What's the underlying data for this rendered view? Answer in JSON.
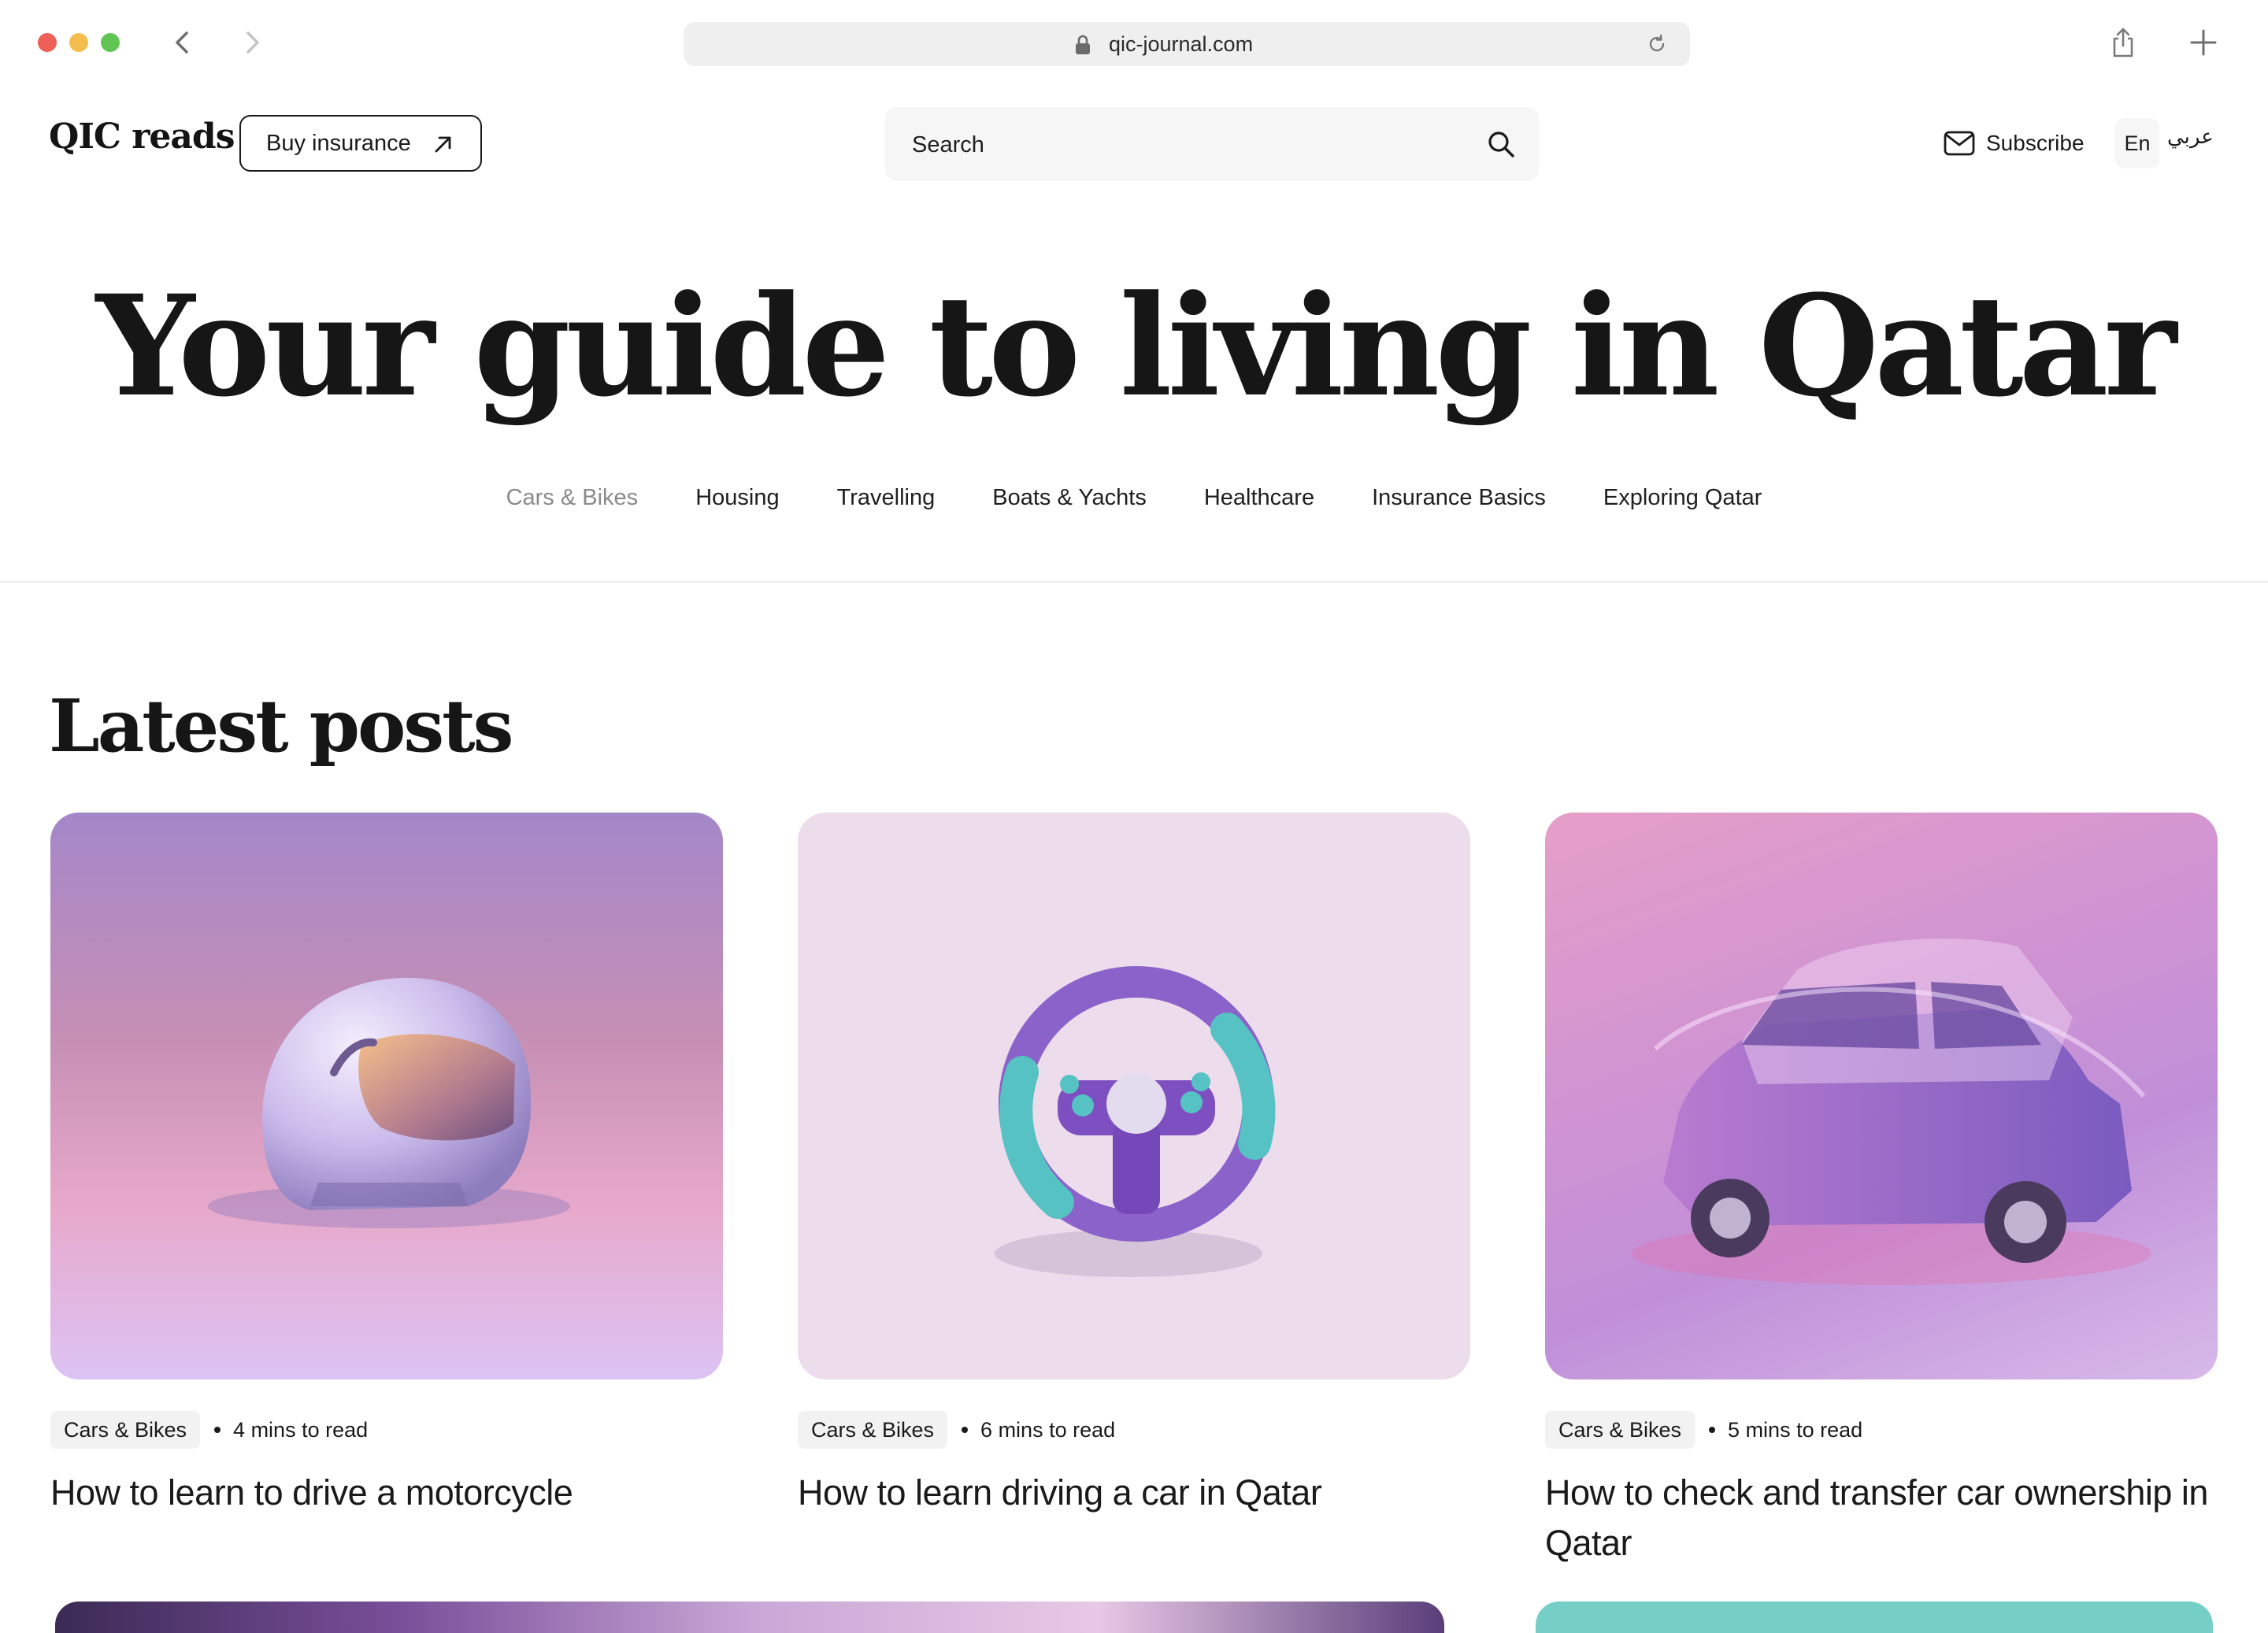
{
  "browser": {
    "url": "qic-journal.com"
  },
  "header": {
    "logo": "QIC reads",
    "buy_label": "Buy insurance",
    "search_placeholder": "Search",
    "subscribe_label": "Subscribe",
    "lang_en": "En",
    "lang_ar": "عربي"
  },
  "hero": {
    "title": "Your guide to living in Qatar"
  },
  "categories": [
    {
      "label": "Cars & Bikes",
      "active": true
    },
    {
      "label": "Housing"
    },
    {
      "label": "Travelling"
    },
    {
      "label": "Boats & Yachts"
    },
    {
      "label": "Healthcare"
    },
    {
      "label": "Insurance Basics"
    },
    {
      "label": "Exploring Qatar"
    }
  ],
  "latest": {
    "title": "Latest posts",
    "posts": [
      {
        "tag": "Cars & Bikes",
        "read_time": "4 mins to read",
        "title": "How to learn to drive a motorcycle",
        "image": "motorcycle-helmet"
      },
      {
        "tag": "Cars & Bikes",
        "read_time": "6 mins to read",
        "title": "How to learn driving a car in Qatar",
        "image": "steering-wheel"
      },
      {
        "tag": "Cars & Bikes",
        "read_time": "5 mins to read",
        "title": "How to check and transfer car ownership in Qatar",
        "image": "wrapped-car"
      }
    ]
  },
  "colors": {
    "traffic_red": "#ee5f57",
    "traffic_yellow": "#f4be4f",
    "traffic_green": "#61c554",
    "text": "#1a1a1a",
    "muted": "#8a8a8a"
  }
}
